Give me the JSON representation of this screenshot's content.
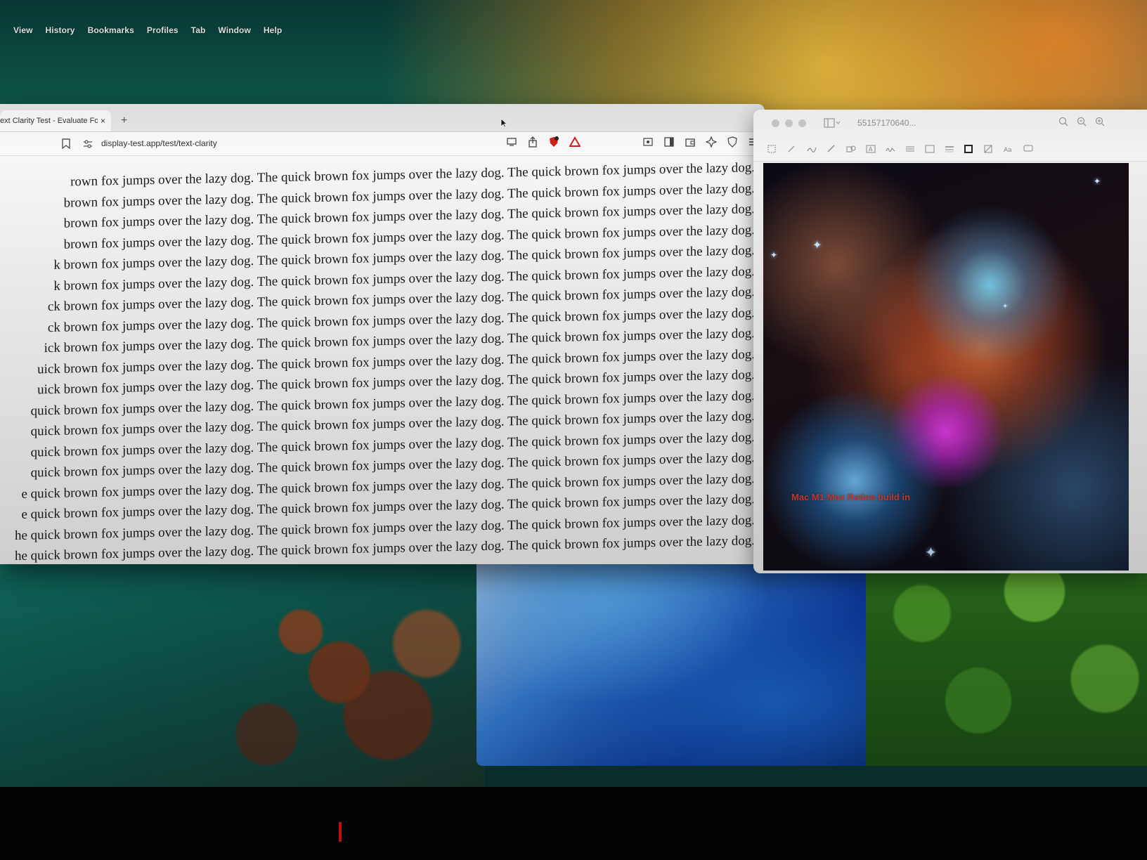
{
  "menubar": {
    "items": [
      "View",
      "History",
      "Bookmarks",
      "Profiles",
      "Tab",
      "Window",
      "Help"
    ]
  },
  "browser": {
    "tab": {
      "title": "ext Clarity Test - Evaluate For",
      "close": "×"
    },
    "new_tab": "+",
    "url": "display-test.app/test/text-clarity",
    "content_lines": [
      "rown fox jumps over the lazy dog. The quick brown fox jumps over the lazy dog. The quick brown fox jumps over the lazy dog.",
      "brown fox jumps over the lazy dog. The quick brown fox jumps over the lazy dog. The quick brown fox jumps over the lazy dog.",
      "brown fox jumps over the lazy dog. The quick brown fox jumps over the lazy dog. The quick brown fox jumps over the lazy dog.",
      "brown fox jumps over the lazy dog. The quick brown fox jumps over the lazy dog. The quick brown fox jumps over the lazy dog.",
      "k brown fox jumps over the lazy dog. The quick brown fox jumps over the lazy dog. The quick brown fox jumps over the lazy dog.",
      "k brown fox jumps over the lazy dog. The quick brown fox jumps over the lazy dog. The quick brown fox jumps over the lazy dog.",
      "ck brown fox jumps over the lazy dog. The quick brown fox jumps over the lazy dog. The quick brown fox jumps over the lazy dog.",
      "ck brown fox jumps over the lazy dog. The quick brown fox jumps over the lazy dog. The quick brown fox jumps over the lazy dog.",
      "ick brown fox jumps over the lazy dog. The quick brown fox jumps over the lazy dog. The quick brown fox jumps over the lazy dog.",
      "uick brown fox jumps over the lazy dog. The quick brown fox jumps over the lazy dog. The quick brown fox jumps over the lazy dog.",
      "uick brown fox jumps over the lazy dog. The quick brown fox jumps over the lazy dog. The quick brown fox jumps over the lazy dog.",
      "quick brown fox jumps over the lazy dog. The quick brown fox jumps over the lazy dog. The quick brown fox jumps over the lazy dog.",
      "quick brown fox jumps over the lazy dog. The quick brown fox jumps over the lazy dog. The quick brown fox jumps over the lazy dog.",
      "quick brown fox jumps over the lazy dog. The quick brown fox jumps over the lazy dog. The quick brown fox jumps over the lazy dog.",
      "quick brown fox jumps over the lazy dog. The quick brown fox jumps over the lazy dog. The quick brown fox jumps over the lazy dog.",
      "e quick brown fox jumps over the lazy dog. The quick brown fox jumps over the lazy dog. The quick brown fox jumps over the lazy dog.",
      "e quick brown fox jumps over the lazy dog. The quick brown fox jumps over the lazy dog. The quick brown fox jumps over the lazy dog.",
      "he quick brown fox jumps over the lazy dog. The quick brown fox jumps over the lazy dog. The quick brown fox jumps over the lazy dog.",
      "he quick brown fox jumps over the lazy dog. The quick brown fox jumps over the lazy dog. The quick brown fox jumps over the lazy dog."
    ]
  },
  "preview": {
    "title": "55157170640...",
    "image_caption": "Mac M1 Max Retina build in"
  },
  "colors": {
    "page_bg": "#f6f6f4",
    "text": "#1a1a1a",
    "caption": "#e0402f",
    "alert_red": "#d0201a"
  },
  "icons": {
    "browser_toolbar": [
      "cast-icon",
      "share-icon",
      "brave-shield-icon",
      "brave-rewards-icon",
      "screenshot-icon",
      "sidebar-icon",
      "wallet-icon",
      "leo-ai-icon",
      "vpn-icon",
      "menu-icon"
    ],
    "preview_tools": [
      "sidebar-toggle-icon",
      "zoom-out-icon",
      "zoom-in-icon",
      "markup-icon"
    ]
  }
}
